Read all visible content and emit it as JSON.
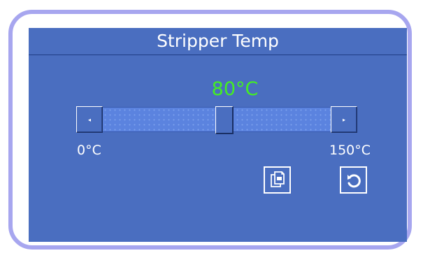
{
  "dialog": {
    "title": "Stripper Temp"
  },
  "slider": {
    "value_label": "80°C",
    "min_label": "0°C",
    "max_label": "150°C",
    "min": 0,
    "max": 150,
    "value": 80,
    "left_arrow": "◂",
    "right_arrow": "▸"
  },
  "actions": {
    "copy_icon": "copy-icon",
    "undo_icon": "undo-icon"
  },
  "colors": {
    "frame": "#a7a6ef",
    "panel": "#4a6ec0",
    "value_text": "#44ef22",
    "text": "#ffffff"
  }
}
